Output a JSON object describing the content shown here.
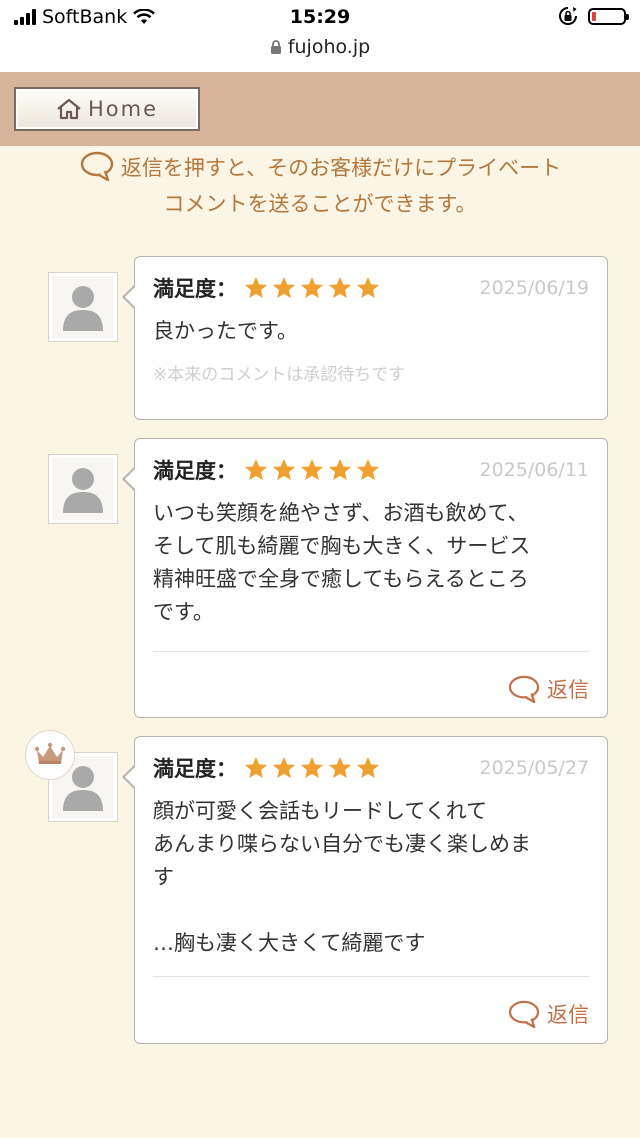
{
  "status_bar": {
    "carrier": "SoftBank",
    "time": "15:29",
    "url": "fujoho.jp"
  },
  "header": {
    "home_label": "Home",
    "accent_color": "#d8b49b"
  },
  "notice": {
    "line1": "返信を押すと、そのお客様だけにプライベート",
    "line2": "コメントを送ることができます。"
  },
  "reviews": [
    {
      "satisfaction_label": "満足度：",
      "rating": 5,
      "date": "2025/06/19",
      "text": "良かったです。",
      "pending_note": "※本来のコメントは承認待ちです",
      "reply_label": "",
      "crown": false
    },
    {
      "satisfaction_label": "満足度：",
      "rating": 5,
      "date": "2025/06/11",
      "text": "いつも笑顔を絶やさず、お酒も飲めて、\nそして肌も綺麗で胸も大きく、サービス\n精神旺盛で全身で癒してもらえるところ\nです。",
      "pending_note": "",
      "reply_label": "返信",
      "crown": false
    },
    {
      "satisfaction_label": "満足度：",
      "rating": 5,
      "date": "2025/05/27",
      "text": "顔が可愛く会話もリードしてくれて\nあんまり喋らない自分でも凄く楽しめま\nす\n\n…胸も凄く大きくて綺麗です",
      "pending_note": "",
      "reply_label": "返信",
      "crown": true
    }
  ],
  "colors": {
    "star": "#f0a030",
    "reply": "#c0714a",
    "notice": "#b3783e"
  }
}
